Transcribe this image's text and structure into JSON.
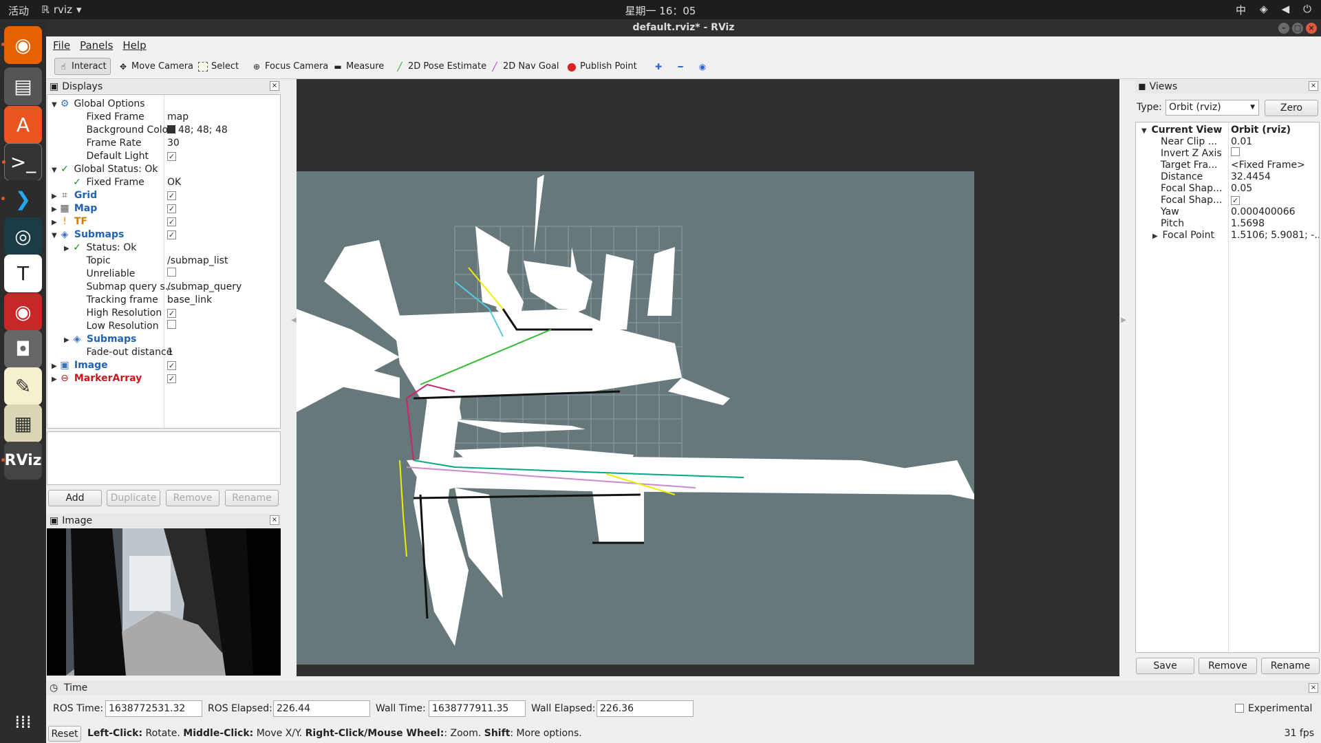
{
  "topbar": {
    "activities": "活动",
    "app_name": "rviz",
    "clock": "星期一 16：05",
    "input_method": "中"
  },
  "window": {
    "title": "default.rviz* - RViz"
  },
  "menu": [
    "File",
    "Panels",
    "Help"
  ],
  "toolbar": {
    "tools": [
      {
        "label": "Interact",
        "icon": "interact-icon"
      },
      {
        "label": "Move Camera",
        "icon": "move-camera-icon"
      },
      {
        "label": "Select",
        "icon": "select-icon"
      },
      {
        "label": "Focus Camera",
        "icon": "focus-camera-icon"
      },
      {
        "label": "Measure",
        "icon": "measure-icon"
      },
      {
        "label": "2D Pose Estimate",
        "icon": "pose-estimate-icon"
      },
      {
        "label": "2D Nav Goal",
        "icon": "nav-goal-icon"
      },
      {
        "label": "Publish Point",
        "icon": "publish-point-icon"
      }
    ],
    "active": "Interact"
  },
  "displays": {
    "title": "Displays",
    "rows": [
      {
        "d": 0,
        "e": "open",
        "name": "Global Options",
        "val": ""
      },
      {
        "d": 1,
        "name": "Fixed Frame",
        "val": "map"
      },
      {
        "d": 1,
        "name": "Background Color",
        "val": "48; 48; 48"
      },
      {
        "d": 1,
        "name": "Frame Rate",
        "val": "30"
      },
      {
        "d": 1,
        "name": "Default Light",
        "val": "✓"
      },
      {
        "d": 0,
        "e": "open",
        "name": "Global Status: Ok",
        "val": ""
      },
      {
        "d": 1,
        "name": "Fixed Frame",
        "val": "OK"
      },
      {
        "d": 0,
        "e": "closed",
        "name": "Grid",
        "val": "✓"
      },
      {
        "d": 0,
        "e": "closed",
        "name": "Map",
        "val": "✓"
      },
      {
        "d": 0,
        "e": "closed",
        "name": "TF",
        "val": "✓"
      },
      {
        "d": 0,
        "e": "open",
        "name": "Submaps",
        "val": "✓"
      },
      {
        "d": 1,
        "e": "closed",
        "name": "Status: Ok",
        "val": ""
      },
      {
        "d": 1,
        "name": "Topic",
        "val": "/submap_list"
      },
      {
        "d": 1,
        "name": "Unreliable",
        "val": ""
      },
      {
        "d": 1,
        "name": "Submap query s...",
        "val": "/submap_query"
      },
      {
        "d": 1,
        "name": "Tracking frame",
        "val": "base_link"
      },
      {
        "d": 1,
        "name": "High Resolution",
        "val": "✓"
      },
      {
        "d": 1,
        "name": "Low Resolution",
        "val": ""
      },
      {
        "d": 1,
        "e": "closed",
        "name": "Submaps",
        "val": ""
      },
      {
        "d": 1,
        "name": "Fade-out distance",
        "val": "1"
      },
      {
        "d": 0,
        "e": "closed",
        "name": "Image",
        "val": "✓"
      },
      {
        "d": 0,
        "e": "closed",
        "name": "MarkerArray",
        "val": "✓"
      }
    ],
    "buttons": [
      "Add",
      "Duplicate",
      "Remove",
      "Rename"
    ]
  },
  "image_panel": {
    "title": "Image"
  },
  "views": {
    "title": "Views",
    "type_label": "Type:",
    "type_value": "Orbit (rviz)",
    "zero": "Zero",
    "rows": [
      {
        "name": "Current View",
        "val": "Orbit (rviz)"
      },
      {
        "name": "Near Clip ...",
        "val": "0.01"
      },
      {
        "name": "Invert Z Axis",
        "val": ""
      },
      {
        "name": "Target Fra...",
        "val": "<Fixed Frame>"
      },
      {
        "name": "Distance",
        "val": "32.4454"
      },
      {
        "name": "Focal Shap...",
        "val": "0.05"
      },
      {
        "name": "Focal Shap...",
        "val": "✓"
      },
      {
        "name": "Yaw",
        "val": "0.000400066"
      },
      {
        "name": "Pitch",
        "val": "1.5698"
      },
      {
        "name": "Focal Point",
        "val": "1.5106; 5.9081; -..."
      }
    ],
    "buttons": [
      "Save",
      "Remove",
      "Rename"
    ]
  },
  "time": {
    "title": "Time",
    "ros_time_label": "ROS Time:",
    "ros_time": "1638772531.32",
    "ros_elapsed_label": "ROS Elapsed:",
    "ros_elapsed": "226.44",
    "wall_time_label": "Wall Time:",
    "wall_time": "1638777911.35",
    "wall_elapsed_label": "Wall Elapsed:",
    "wall_elapsed": "226.36",
    "experimental": "Experimental"
  },
  "status": {
    "reset": "Reset",
    "lc": "Left-Click:",
    "lc_t": " Rotate. ",
    "mc": "Middle-Click:",
    "mc_t": " Move X/Y. ",
    "rc": "Right-Click/Mouse Wheel:",
    "rc_t": ": Zoom. ",
    "sh": "Shift",
    "sh_t": ": More options.",
    "fps": "31 fps"
  }
}
